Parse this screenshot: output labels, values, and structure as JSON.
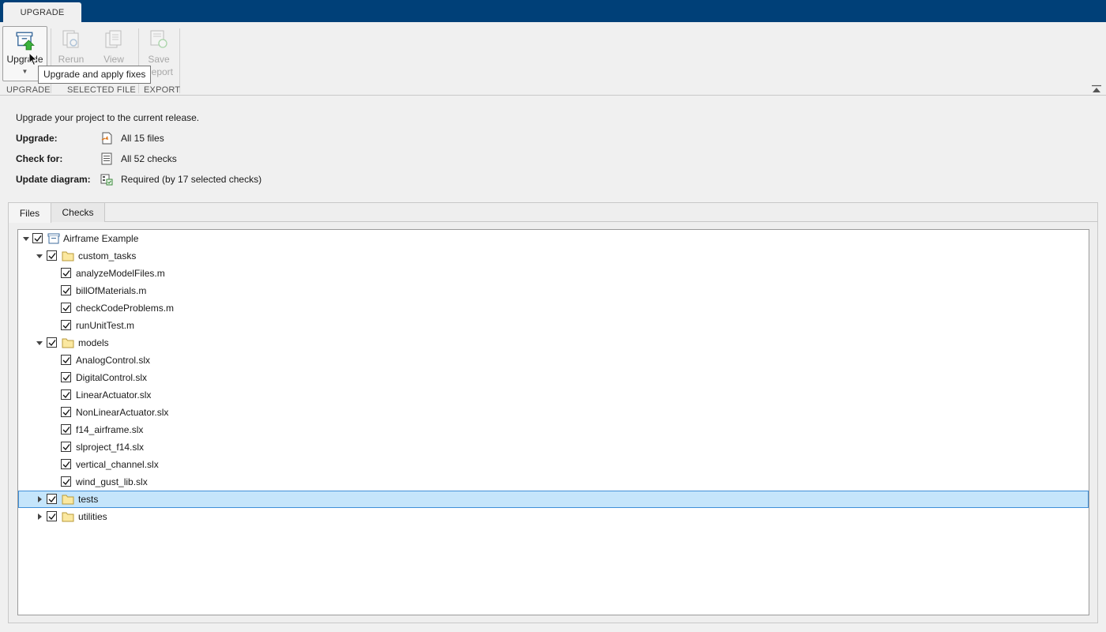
{
  "tabstrip": {
    "active_tab": "UPGRADE"
  },
  "toolstrip": {
    "upgrade_label": "Upgrade",
    "rerun_label": "Rerun",
    "view_label": "View",
    "save_label": "Save",
    "save_label2": "Report",
    "sections": {
      "upgrade": "UPGRADE",
      "selected_file": "SELECTED FILE",
      "export": "EXPORT"
    }
  },
  "tooltip": "Upgrade and apply fixes",
  "summary": {
    "intro": "Upgrade your project to the current release.",
    "rows": [
      {
        "key": "Upgrade:",
        "value": "All 15 files",
        "icon": "model-file-icon"
      },
      {
        "key": "Check for:",
        "value": "All 52 checks",
        "icon": "checklist-icon"
      },
      {
        "key": "Update diagram:",
        "value": "Required (by 17 selected checks)",
        "icon": "update-diagram-icon"
      }
    ]
  },
  "tabs": {
    "files": "Files",
    "checks": "Checks",
    "active": "Files"
  },
  "tree": {
    "root": "Airframe Example",
    "custom_tasks": "custom_tasks",
    "custom_tasks_files": [
      "analyzeModelFiles.m",
      "billOfMaterials.m",
      "checkCodeProblems.m",
      "runUnitTest.m"
    ],
    "models": "models",
    "models_files": [
      "AnalogControl.slx",
      "DigitalControl.slx",
      "LinearActuator.slx",
      "NonLinearActuator.slx",
      "f14_airframe.slx",
      "slproject_f14.slx",
      "vertical_channel.slx",
      "wind_gust_lib.slx"
    ],
    "tests": "tests",
    "utilities": "utilities",
    "selected": "tests"
  },
  "colors": {
    "tabstrip": "#004078",
    "selection": "#c5e5fb",
    "selection_border": "#3f8fd8",
    "upgrade_arrow": "#3cb43c"
  }
}
